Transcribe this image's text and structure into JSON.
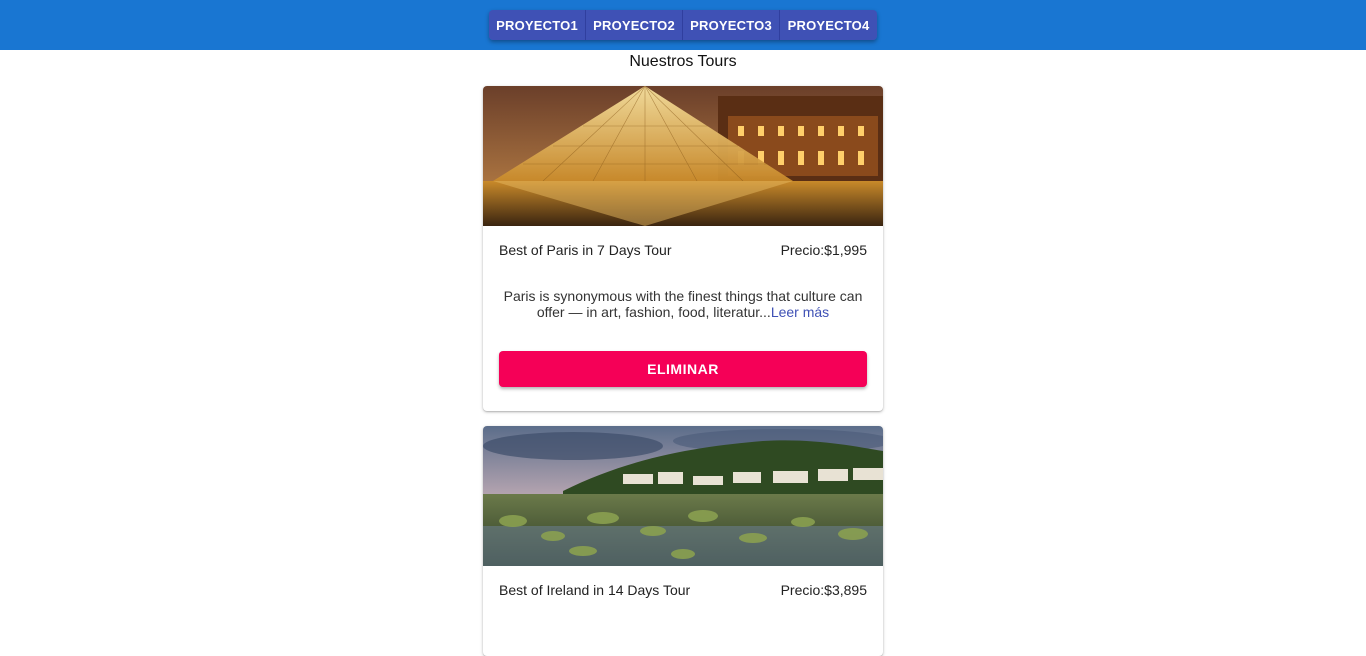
{
  "nav": {
    "buttons": [
      "PROYECTO1",
      "PROYECTO2",
      "PROYECTO3",
      "PROYECTO4"
    ]
  },
  "page": {
    "title": "Nuestros Tours"
  },
  "tours": [
    {
      "name": "Best of Paris in 7 Days Tour",
      "price": "Precio:$1,995",
      "description": "Paris is synonymous with the finest things that culture can offer — in art, fashion, food, literatur...",
      "read_more": "Leer más",
      "delete_label": "ELIMINAR"
    },
    {
      "name": "Best of Ireland in 14 Days Tour",
      "price": "Precio:$3,895"
    }
  ],
  "colors": {
    "appbar": "#1976d2",
    "nav_button": "#3f51b5",
    "delete_button": "#f50057",
    "link": "#3f51b5"
  }
}
